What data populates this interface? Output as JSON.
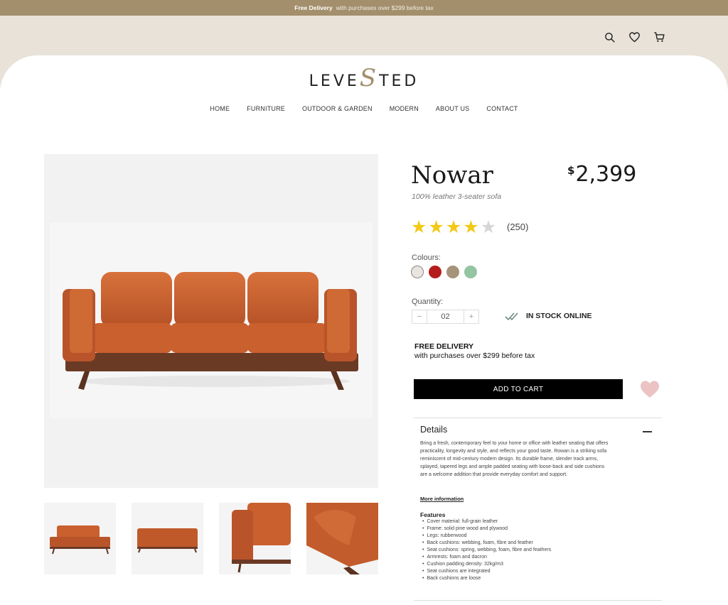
{
  "promo": {
    "bold": "Free Delivery",
    "rest": "with purchases over $299 before tax"
  },
  "header_icons": [
    "search-icon",
    "heart-icon",
    "cart-icon"
  ],
  "brand": {
    "before": "LEVE",
    "s": "S",
    "after": "TED",
    "accent": "#a38f6c"
  },
  "nav": [
    "HOME",
    "FURNITURE",
    "OUTDOOR & GARDEN",
    "MODERN",
    "ABOUT US",
    "CONTACT"
  ],
  "product": {
    "name": "Nowar",
    "subtitle": "100% leather 3-seater sofa",
    "currency": "$",
    "price": "2,399",
    "rating": 4,
    "rating_max": 5,
    "rating_count": "(250)",
    "colours_label": "Colours:",
    "colours": [
      "#e9e4df",
      "#b51d1d",
      "#a59479",
      "#94c4a2"
    ],
    "quantity_label": "Quantity:",
    "quantity": "02",
    "minus": "−",
    "plus": "+",
    "stock": "IN STOCK ONLINE",
    "delivery_title": "FREE DELIVERY",
    "delivery_text": "with purchases over $299 before tax",
    "add_to_cart": "ADD TO CART",
    "wishlist_color": "#ebc3c3"
  },
  "details": {
    "heading": "Details",
    "body": "Bring a fresh, contemporary feel to your home or office with leather seating that offers practicality, longevity and style, and reflects your good taste. Rowan is a striking sofa reminiscent of mid-century modern design. Its durable frame, slender track arms, splayed, tapered legs and ample padded seating with loose-back and side cushions are a welcome addition that provide everyday comfort and support.",
    "more": "More information",
    "features_heading": "Features",
    "features": [
      "Cover material: full-grain leather",
      "Frame: solid pine wood and plywood",
      "Legs: rubberwood",
      "Back cushions: webbing, foam, fibre and feather",
      "Seat cushions: spring, webbing, foam, fibre and feathers",
      "Armrests: foam and dacron",
      "Cushion padding density: 32kg/m3",
      "Seat cushions are integrated",
      "Back cushions are loose"
    ]
  }
}
